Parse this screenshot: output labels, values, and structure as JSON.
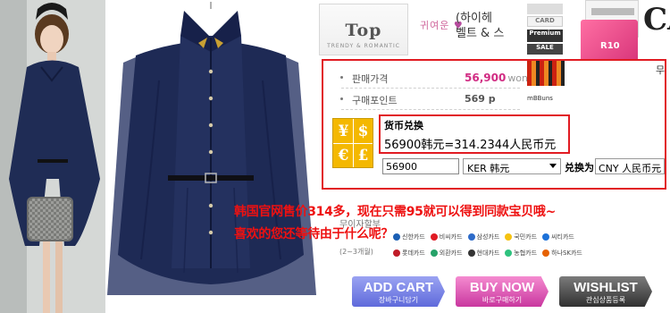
{
  "header": {
    "title": "Top",
    "tagline": "TRENDY & ROMANTIC",
    "deco_text": "귀여운",
    "tag_line1": "(하이헤",
    "tag_line2": "벨트 & 스"
  },
  "ads": {
    "card_label": "R10",
    "brand_partial": "CA",
    "small_labels": [
      "",
      "CARD",
      "Premium",
      "SALE"
    ]
  },
  "price": {
    "sale_price_label": "판매가격",
    "sale_price_value": "56,900",
    "sale_price_unit": "won",
    "points_label": "구매포인트",
    "points_value": "569 p",
    "mbb_label": "mBBuns",
    "partial_right": "무"
  },
  "converter": {
    "title": "货币兑换",
    "result": "56900韩元=314.2344人民币元",
    "amount_value": "56900",
    "from_currency": "KER 韩元",
    "convert_label": "兑换为",
    "to_currency": "CNY 人民币元"
  },
  "promo": {
    "line1": "韩国官网售价314多，现在只需95就可以得到同款宝贝哦~",
    "line2": "喜欢的您还等待由于什么呢？"
  },
  "faint": {
    "line1": "무이자할부",
    "line2": "(2~3개월)"
  },
  "cards_row1": [
    "신한카드",
    "비씨카드",
    "삼성카드",
    "국민카드",
    "씨티카드"
  ],
  "cards_row2": [
    "롯데카드",
    "외환카드",
    "현대카드",
    "농협카드",
    "하나SK카드"
  ],
  "card_colors": [
    "#1a5fb4",
    "#e01b24",
    "#2d6bc9",
    "#f5c211",
    "#1c71d8",
    "#c01c28",
    "#26a269",
    "#333333",
    "#2ec27e",
    "#e66100"
  ],
  "buttons": {
    "add_cart": "ADD CART",
    "add_cart_sub": "장바구니담기",
    "buy_now": "BUY NOW",
    "buy_now_sub": "바로구매하기",
    "wishlist": "WISHLIST",
    "wishlist_sub": "관심상품등록"
  },
  "colors": {
    "accent_red": "#e11b22",
    "price_pink": "#d12c83",
    "coat_navy": "#1e2a55",
    "fx_gold": "#f4b800"
  }
}
